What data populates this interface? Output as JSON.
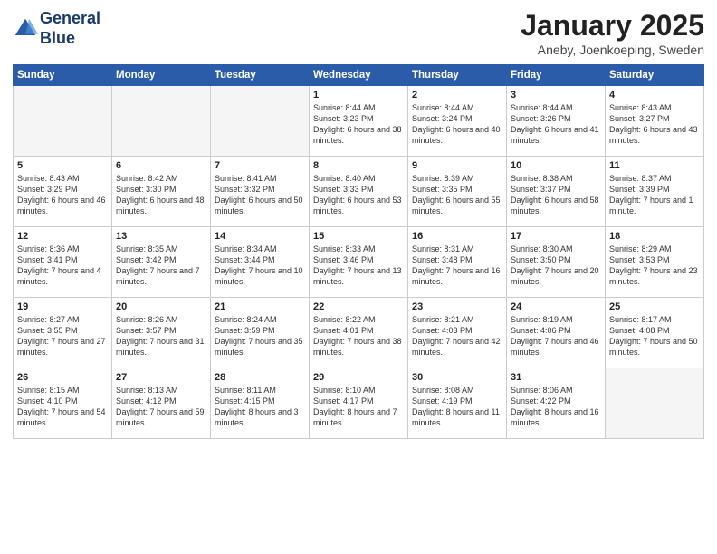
{
  "header": {
    "logo_line1": "General",
    "logo_line2": "Blue",
    "month_title": "January 2025",
    "location": "Aneby, Joenkoeping, Sweden"
  },
  "days_of_week": [
    "Sunday",
    "Monday",
    "Tuesday",
    "Wednesday",
    "Thursday",
    "Friday",
    "Saturday"
  ],
  "weeks": [
    [
      {
        "num": "",
        "info": ""
      },
      {
        "num": "",
        "info": ""
      },
      {
        "num": "",
        "info": ""
      },
      {
        "num": "1",
        "info": "Sunrise: 8:44 AM\nSunset: 3:23 PM\nDaylight: 6 hours and 38 minutes."
      },
      {
        "num": "2",
        "info": "Sunrise: 8:44 AM\nSunset: 3:24 PM\nDaylight: 6 hours and 40 minutes."
      },
      {
        "num": "3",
        "info": "Sunrise: 8:44 AM\nSunset: 3:26 PM\nDaylight: 6 hours and 41 minutes."
      },
      {
        "num": "4",
        "info": "Sunrise: 8:43 AM\nSunset: 3:27 PM\nDaylight: 6 hours and 43 minutes."
      }
    ],
    [
      {
        "num": "5",
        "info": "Sunrise: 8:43 AM\nSunset: 3:29 PM\nDaylight: 6 hours and 46 minutes."
      },
      {
        "num": "6",
        "info": "Sunrise: 8:42 AM\nSunset: 3:30 PM\nDaylight: 6 hours and 48 minutes."
      },
      {
        "num": "7",
        "info": "Sunrise: 8:41 AM\nSunset: 3:32 PM\nDaylight: 6 hours and 50 minutes."
      },
      {
        "num": "8",
        "info": "Sunrise: 8:40 AM\nSunset: 3:33 PM\nDaylight: 6 hours and 53 minutes."
      },
      {
        "num": "9",
        "info": "Sunrise: 8:39 AM\nSunset: 3:35 PM\nDaylight: 6 hours and 55 minutes."
      },
      {
        "num": "10",
        "info": "Sunrise: 8:38 AM\nSunset: 3:37 PM\nDaylight: 6 hours and 58 minutes."
      },
      {
        "num": "11",
        "info": "Sunrise: 8:37 AM\nSunset: 3:39 PM\nDaylight: 7 hours and 1 minute."
      }
    ],
    [
      {
        "num": "12",
        "info": "Sunrise: 8:36 AM\nSunset: 3:41 PM\nDaylight: 7 hours and 4 minutes."
      },
      {
        "num": "13",
        "info": "Sunrise: 8:35 AM\nSunset: 3:42 PM\nDaylight: 7 hours and 7 minutes."
      },
      {
        "num": "14",
        "info": "Sunrise: 8:34 AM\nSunset: 3:44 PM\nDaylight: 7 hours and 10 minutes."
      },
      {
        "num": "15",
        "info": "Sunrise: 8:33 AM\nSunset: 3:46 PM\nDaylight: 7 hours and 13 minutes."
      },
      {
        "num": "16",
        "info": "Sunrise: 8:31 AM\nSunset: 3:48 PM\nDaylight: 7 hours and 16 minutes."
      },
      {
        "num": "17",
        "info": "Sunrise: 8:30 AM\nSunset: 3:50 PM\nDaylight: 7 hours and 20 minutes."
      },
      {
        "num": "18",
        "info": "Sunrise: 8:29 AM\nSunset: 3:53 PM\nDaylight: 7 hours and 23 minutes."
      }
    ],
    [
      {
        "num": "19",
        "info": "Sunrise: 8:27 AM\nSunset: 3:55 PM\nDaylight: 7 hours and 27 minutes."
      },
      {
        "num": "20",
        "info": "Sunrise: 8:26 AM\nSunset: 3:57 PM\nDaylight: 7 hours and 31 minutes."
      },
      {
        "num": "21",
        "info": "Sunrise: 8:24 AM\nSunset: 3:59 PM\nDaylight: 7 hours and 35 minutes."
      },
      {
        "num": "22",
        "info": "Sunrise: 8:22 AM\nSunset: 4:01 PM\nDaylight: 7 hours and 38 minutes."
      },
      {
        "num": "23",
        "info": "Sunrise: 8:21 AM\nSunset: 4:03 PM\nDaylight: 7 hours and 42 minutes."
      },
      {
        "num": "24",
        "info": "Sunrise: 8:19 AM\nSunset: 4:06 PM\nDaylight: 7 hours and 46 minutes."
      },
      {
        "num": "25",
        "info": "Sunrise: 8:17 AM\nSunset: 4:08 PM\nDaylight: 7 hours and 50 minutes."
      }
    ],
    [
      {
        "num": "26",
        "info": "Sunrise: 8:15 AM\nSunset: 4:10 PM\nDaylight: 7 hours and 54 minutes."
      },
      {
        "num": "27",
        "info": "Sunrise: 8:13 AM\nSunset: 4:12 PM\nDaylight: 7 hours and 59 minutes."
      },
      {
        "num": "28",
        "info": "Sunrise: 8:11 AM\nSunset: 4:15 PM\nDaylight: 8 hours and 3 minutes."
      },
      {
        "num": "29",
        "info": "Sunrise: 8:10 AM\nSunset: 4:17 PM\nDaylight: 8 hours and 7 minutes."
      },
      {
        "num": "30",
        "info": "Sunrise: 8:08 AM\nSunset: 4:19 PM\nDaylight: 8 hours and 11 minutes."
      },
      {
        "num": "31",
        "info": "Sunrise: 8:06 AM\nSunset: 4:22 PM\nDaylight: 8 hours and 16 minutes."
      },
      {
        "num": "",
        "info": ""
      }
    ]
  ]
}
